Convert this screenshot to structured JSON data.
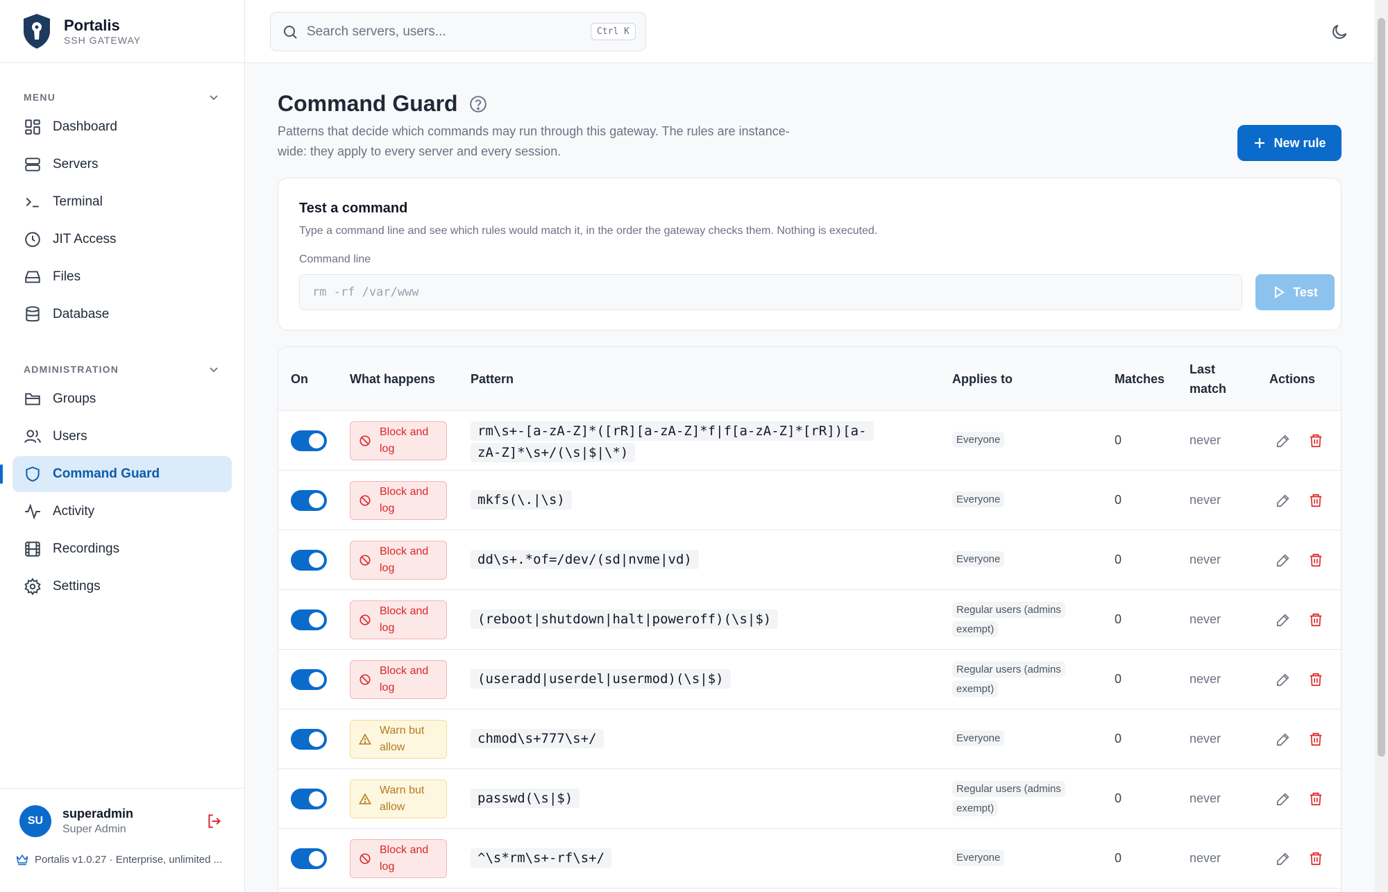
{
  "brand": {
    "name": "Portalis",
    "subtitle": "SSH GATEWAY"
  },
  "search": {
    "placeholder": "Search servers, users...",
    "shortcut": "Ctrl K"
  },
  "sidebar": {
    "menu_title": "MENU",
    "menu_items": [
      {
        "label": "Dashboard",
        "icon": "dashboard-icon"
      },
      {
        "label": "Servers",
        "icon": "server-icon"
      },
      {
        "label": "Terminal",
        "icon": "terminal-icon"
      },
      {
        "label": "JIT Access",
        "icon": "clock-icon"
      },
      {
        "label": "Files",
        "icon": "drive-icon"
      },
      {
        "label": "Database",
        "icon": "database-icon"
      }
    ],
    "admin_title": "ADMINISTRATION",
    "admin_items": [
      {
        "label": "Groups",
        "icon": "folder-icon"
      },
      {
        "label": "Users",
        "icon": "users-icon"
      },
      {
        "label": "Command Guard",
        "icon": "shield-icon",
        "active": true
      },
      {
        "label": "Activity",
        "icon": "activity-icon"
      },
      {
        "label": "Recordings",
        "icon": "film-icon"
      },
      {
        "label": "Settings",
        "icon": "gear-icon"
      }
    ]
  },
  "user": {
    "initials": "SU",
    "name": "superadmin",
    "role": "Super Admin",
    "version": "Portalis v1.0.27 · Enterprise, unlimited ..."
  },
  "page": {
    "title": "Command Guard",
    "description": "Patterns that decide which commands may run through this gateway. The rules are instance-wide: they apply to every server and every session.",
    "new_rule_label": "New rule"
  },
  "tester": {
    "title": "Test a command",
    "description": "Type a command line and see which rules would match it, in the order the gateway checks them. Nothing is executed.",
    "field_label": "Command line",
    "placeholder": "rm -rf /var/www",
    "button_label": "Test"
  },
  "table": {
    "headers": {
      "on": "On",
      "action": "What happens",
      "pattern": "Pattern",
      "applies": "Applies to",
      "matches": "Matches",
      "last_match": "Last match",
      "actions": "Actions"
    },
    "rows": [
      {
        "enabled": true,
        "action": "Block and log",
        "kind": "block",
        "pattern": "rm\\s+-[a-zA-Z]*([rR][a-zA-Z]*f|f[a-zA-Z]*[rR])[a-zA-Z]*\\s+/(\\s|$|\\*)",
        "applies": "Everyone",
        "matches": "0",
        "last_match": "never"
      },
      {
        "enabled": true,
        "action": "Block and log",
        "kind": "block",
        "pattern": "mkfs(\\.|\\s)",
        "applies": "Everyone",
        "matches": "0",
        "last_match": "never"
      },
      {
        "enabled": true,
        "action": "Block and log",
        "kind": "block",
        "pattern": "dd\\s+.*of=/dev/(sd|nvme|vd)",
        "applies": "Everyone",
        "matches": "0",
        "last_match": "never"
      },
      {
        "enabled": true,
        "action": "Block and log",
        "kind": "block",
        "pattern": "(reboot|shutdown|halt|poweroff)(\\s|$)",
        "applies": "Regular users (admins exempt)",
        "matches": "0",
        "last_match": "never"
      },
      {
        "enabled": true,
        "action": "Block and log",
        "kind": "block",
        "pattern": "(useradd|userdel|usermod)(\\s|$)",
        "applies": "Regular users (admins exempt)",
        "matches": "0",
        "last_match": "never"
      },
      {
        "enabled": true,
        "action": "Warn but allow",
        "kind": "warn",
        "pattern": "chmod\\s+777\\s+/",
        "applies": "Everyone",
        "matches": "0",
        "last_match": "never"
      },
      {
        "enabled": true,
        "action": "Warn but allow",
        "kind": "warn",
        "pattern": "passwd(\\s|$)",
        "applies": "Regular users (admins exempt)",
        "matches": "0",
        "last_match": "never"
      },
      {
        "enabled": true,
        "action": "Block and log",
        "kind": "block",
        "pattern": "^\\s*rm\\s+-rf\\s+/",
        "applies": "Everyone",
        "matches": "0",
        "last_match": "never"
      }
    ]
  },
  "colors": {
    "accent": "#0b6bcb",
    "block": "#dc2626",
    "warn": "#b7791f"
  }
}
